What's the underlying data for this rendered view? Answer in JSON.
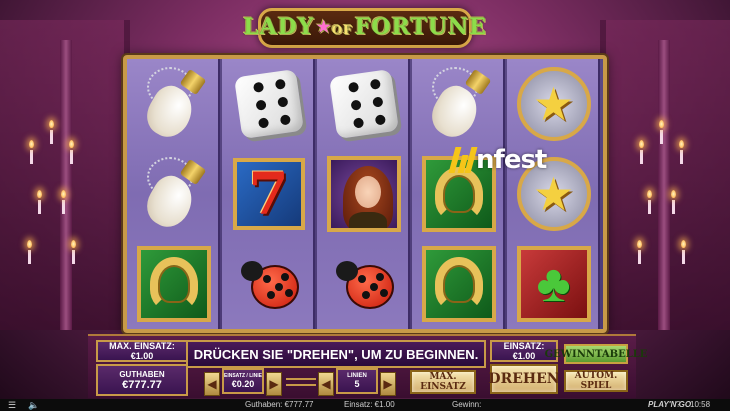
{
  "game": {
    "logo_part1": "LADY",
    "logo_of": "OF",
    "logo_part2": "FORTUNE",
    "watermark": "nfest"
  },
  "reels": [
    [
      "rabbit-foot",
      "rabbit-foot",
      "horseshoe"
    ],
    [
      "dice",
      "seven",
      "ladybug"
    ],
    [
      "dice",
      "lady",
      "ladybug"
    ],
    [
      "rabbit-foot",
      "horseshoe",
      "horseshoe"
    ],
    [
      "shooting-star",
      "shooting-star",
      "four-leaf-clover"
    ]
  ],
  "panel": {
    "max_bet_label": "MAX. EINSATZ: €1.00",
    "message": "DRÜCKEN SIE \"DREHEN\", UM ZU BEGINNEN.",
    "balance_label": "GUTHABEN",
    "balance_value": "€777.77",
    "bet_per_line_label": "EINSATZ / LINIE",
    "bet_per_line_value": "€0.20",
    "lines_label": "LINIEN",
    "lines_value": "5",
    "total_bet_label": "EINSATZ: €1.00",
    "paytable_button": "GEWINNTABELLE",
    "max_bet_button": "MAX. EINSATZ",
    "spin_button": "DREHEN",
    "autoplay_button": "AUTOM. SPIEL"
  },
  "statusbar": {
    "balance": "Guthaben: €777.77",
    "bet": "Einsatz: €1.00",
    "win": "Gewinn:",
    "provider": "PLAY'N GO",
    "time": "10:58"
  },
  "colors": {
    "frame_gold": "#c89a48",
    "reel_bg": "#8c79bd",
    "panel_bg": "#5a1c48"
  }
}
